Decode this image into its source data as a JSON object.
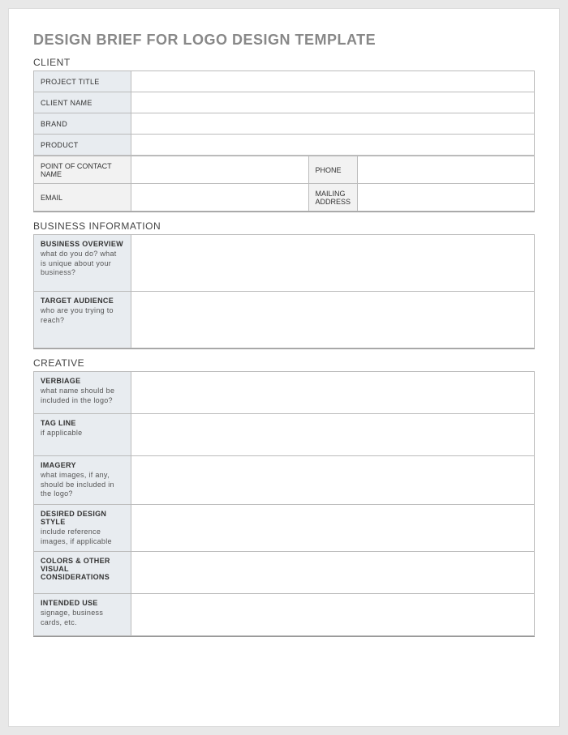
{
  "title": "DESIGN BRIEF FOR LOGO DESIGN TEMPLATE",
  "sections": {
    "client": {
      "heading": "CLIENT",
      "rows": {
        "project_title": {
          "label": "PROJECT TITLE",
          "value": ""
        },
        "client_name": {
          "label": "CLIENT NAME",
          "value": ""
        },
        "brand": {
          "label": "BRAND",
          "value": ""
        },
        "product": {
          "label": "PRODUCT",
          "value": ""
        },
        "poc_name": {
          "label": "POINT OF CONTACT NAME",
          "value": ""
        },
        "phone": {
          "label": "PHONE",
          "value": ""
        },
        "email": {
          "label": "EMAIL",
          "value": ""
        },
        "mailing": {
          "label": "MAILING ADDRESS",
          "value": ""
        }
      }
    },
    "business": {
      "heading": "BUSINESS INFORMATION",
      "rows": {
        "overview": {
          "label": "BUSINESS OVERVIEW",
          "sub": "what do you do? what is unique about your business?",
          "value": ""
        },
        "audience": {
          "label": "TARGET AUDIENCE",
          "sub": "who are you trying to reach?",
          "value": ""
        }
      }
    },
    "creative": {
      "heading": "CREATIVE",
      "rows": {
        "verbiage": {
          "label": "VERBIAGE",
          "sub": "what name should be included in the logo?",
          "value": ""
        },
        "tagline": {
          "label": "TAG LINE",
          "sub": "if applicable",
          "value": ""
        },
        "imagery": {
          "label": "IMAGERY",
          "sub": "what images, if any, should be included in the logo?",
          "value": ""
        },
        "style": {
          "label": "DESIRED DESIGN STYLE",
          "sub": "include reference images, if applicable",
          "value": ""
        },
        "colors": {
          "label": "COLORS & OTHER VISUAL CONSIDERATIONS",
          "sub": "",
          "value": ""
        },
        "use": {
          "label": "INTENDED USE",
          "sub": "signage, business cards, etc.",
          "value": ""
        }
      }
    }
  }
}
